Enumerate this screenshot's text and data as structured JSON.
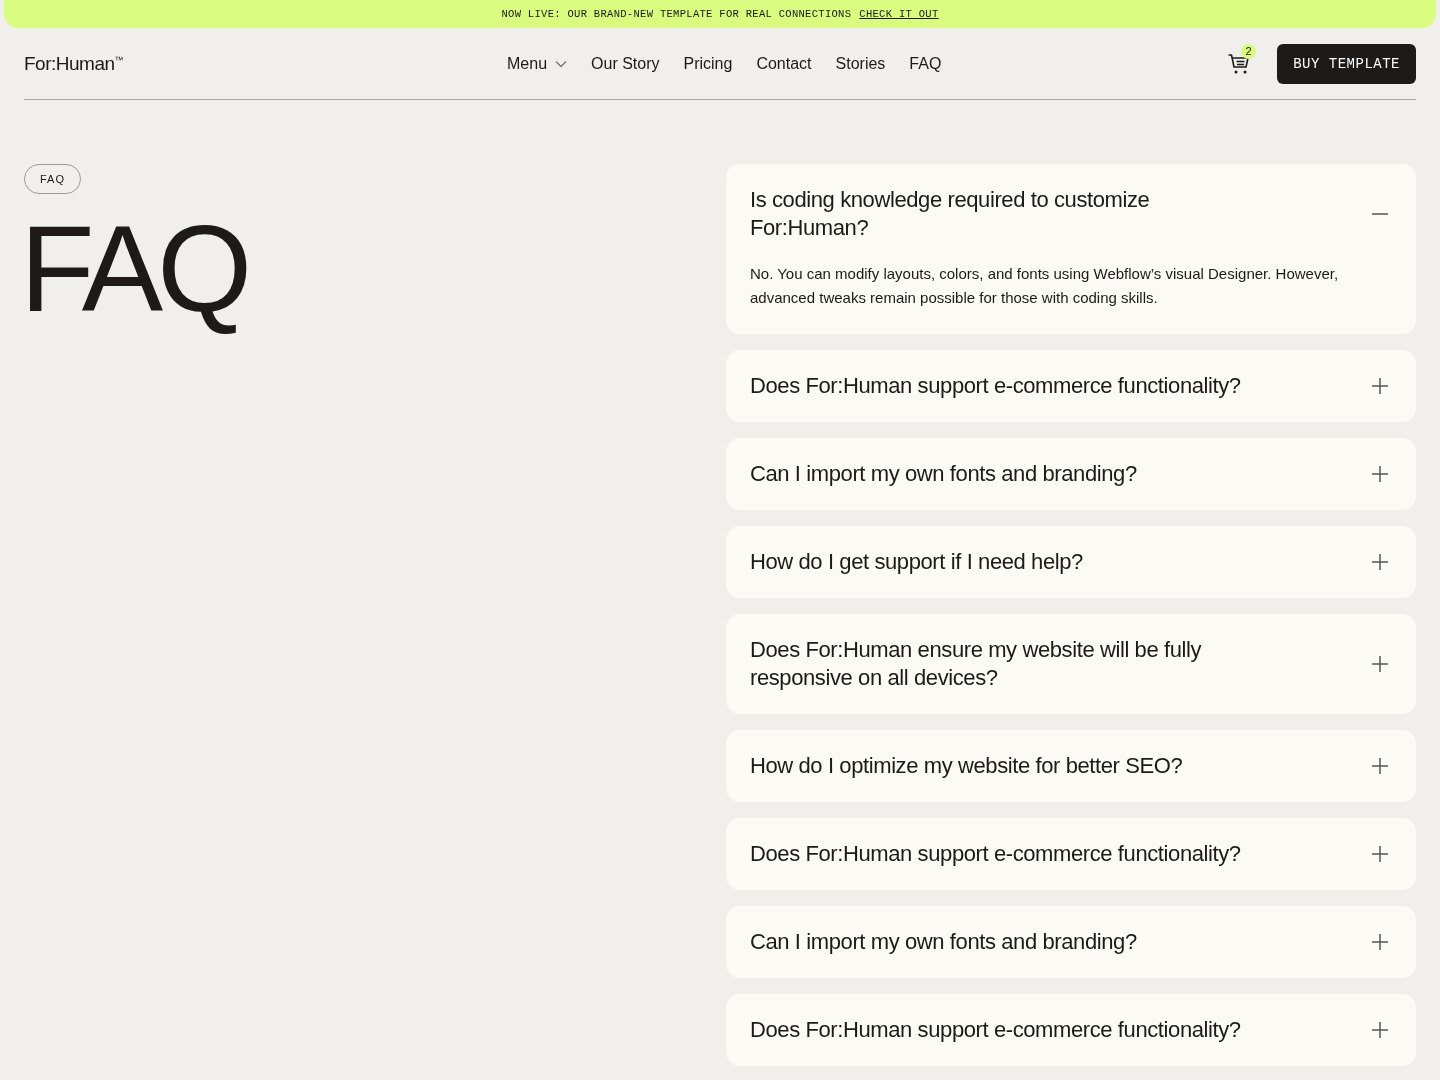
{
  "banner": {
    "text": "NOW LIVE: OUR BRAND-NEW TEMPLATE FOR REAL CONNECTIONS",
    "link": "CHECK IT OUT"
  },
  "header": {
    "logo": "For:Human$^{™}$",
    "nav": [
      {
        "label": "Menu",
        "kind": "dropdown"
      },
      {
        "label": "Our Story",
        "kind": "link"
      },
      {
        "label": "Pricing",
        "kind": "link"
      },
      {
        "label": "Contact",
        "kind": "link"
      },
      {
        "label": "Stories",
        "kind": "link"
      },
      {
        "label": "FAQ",
        "kind": "link"
      }
    ],
    "cart_count": "2",
    "cta": "BUY TEMPLATE"
  },
  "section": {
    "tag": "FAQ",
    "title": "FAQ"
  },
  "faq": [
    {
      "question": "Is coding knowledge required to customize For:Human?",
      "expanded": true,
      "answer": "No. You can modify layouts, colors, and fonts using Webflow’s visual Designer. However, advanced tweaks remain possible for those with coding skills."
    },
    {
      "question": "Does For:Human support e-commerce functionality?",
      "expanded": false
    },
    {
      "question": "Can I import my own fonts and branding?",
      "expanded": false
    },
    {
      "question": "How do I get support if I need help?",
      "expanded": false
    },
    {
      "question": "Does For:Human ensure my website will be fully responsive on all devices?",
      "expanded": false
    },
    {
      "question": "How do I optimize my website for better SEO?",
      "expanded": false
    },
    {
      "question": "Does For:Human support e-commerce functionality?",
      "expanded": false
    },
    {
      "question": "Can I import my own fonts and branding?",
      "expanded": false
    },
    {
      "question": "Does For:Human support e-commerce functionality?",
      "expanded": false
    }
  ]
}
